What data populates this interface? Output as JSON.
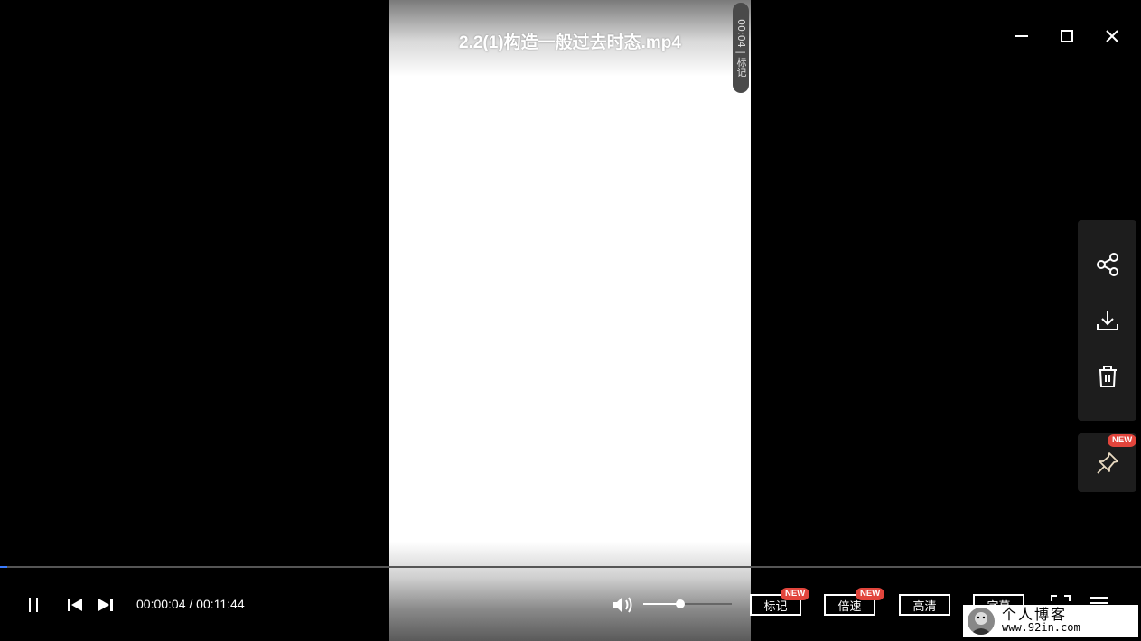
{
  "video": {
    "title": "2.2(1)构造一般过去时态.mp4"
  },
  "side_tag": {
    "text": "00:04 | 标记"
  },
  "window_controls": {
    "minimize": "minimize-icon",
    "maximize": "maximize-icon",
    "close": "close-icon"
  },
  "right_panel": {
    "items": [
      "share-icon",
      "download-icon",
      "trash-icon"
    ],
    "pin_badge": "NEW"
  },
  "player": {
    "progress": 0.006,
    "time": "00:00:04 / 00:11:44",
    "volume": 0.42,
    "buttons": [
      {
        "label": "标记",
        "badge": "NEW"
      },
      {
        "label": "倍速",
        "badge": "NEW"
      },
      {
        "label": "高清",
        "badge": ""
      },
      {
        "label": "字幕",
        "badge": ""
      }
    ]
  },
  "watermark": {
    "line1": "个人博客",
    "line2": "www.92in.com"
  },
  "colors": {
    "accent": "#3a7bff",
    "badge": "#e2453c",
    "panel": "#1d1d1d"
  }
}
